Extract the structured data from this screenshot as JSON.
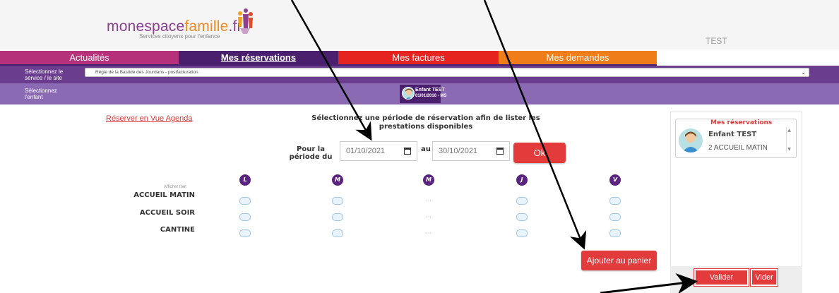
{
  "header": {
    "logo_part1": "monespace",
    "logo_part2": "famille",
    "logo_part3": ".fr",
    "logo_tagline": "Services citoyens pour l'enfance",
    "user_name": "TEST"
  },
  "tabs": [
    {
      "label": "Actualités",
      "color": "#b5327a"
    },
    {
      "label": "Mes réservations",
      "color": "#4a1f6d",
      "active": true
    },
    {
      "label": "Mes factures",
      "color": "#e52420"
    },
    {
      "label": "Mes demandes",
      "color": "#ef7d1a"
    }
  ],
  "site_bar": {
    "label_line1": "Sélectionnez le",
    "label_line2": "service / le site",
    "selected_value": "Régie de la Bastide des Jourdans - postfacturation"
  },
  "child_bar": {
    "label_line1": "Sélectionnez",
    "label_line2": "l'enfant",
    "child_name": "Enfant TEST",
    "child_info": "01/01/2016 - MS"
  },
  "main": {
    "agenda_link": "Réserver en Vue Agenda",
    "instruction": "Sélectionnez une période de réservation afin de lister les prestations disponibles",
    "period_label": "Pour la période du",
    "date_from": "01/10/2021",
    "date_separator": "au",
    "date_to": "30/10/2021",
    "ok_label": "Ok"
  },
  "grid": {
    "show_all": "Afficher tout",
    "days": [
      "L",
      "M",
      "M",
      "J",
      "V"
    ],
    "rows": [
      {
        "label": "ACCUEIL MATIN",
        "cells": [
          "check",
          "check",
          "dots",
          "check",
          "check"
        ]
      },
      {
        "label": "ACCUEIL SOIR",
        "cells": [
          "check",
          "check",
          "dots",
          "check",
          "check"
        ]
      },
      {
        "label": "CANTINE",
        "cells": [
          "check",
          "check",
          "dots",
          "check",
          "check"
        ]
      }
    ],
    "dots_text": "···",
    "add_to_cart": "Ajouter au panier"
  },
  "panel": {
    "title": "Mes réservations",
    "child_name": "Enfant TEST",
    "detail": "2 ACCUEIL MATIN",
    "validate_label": "Valider",
    "empty_label": "Vider"
  },
  "colors": {
    "accent_red": "#e33b3b",
    "purple_dark": "#4a1f6d",
    "purple_mid": "#6b3d8e",
    "purple_light": "#8a6ab2"
  }
}
